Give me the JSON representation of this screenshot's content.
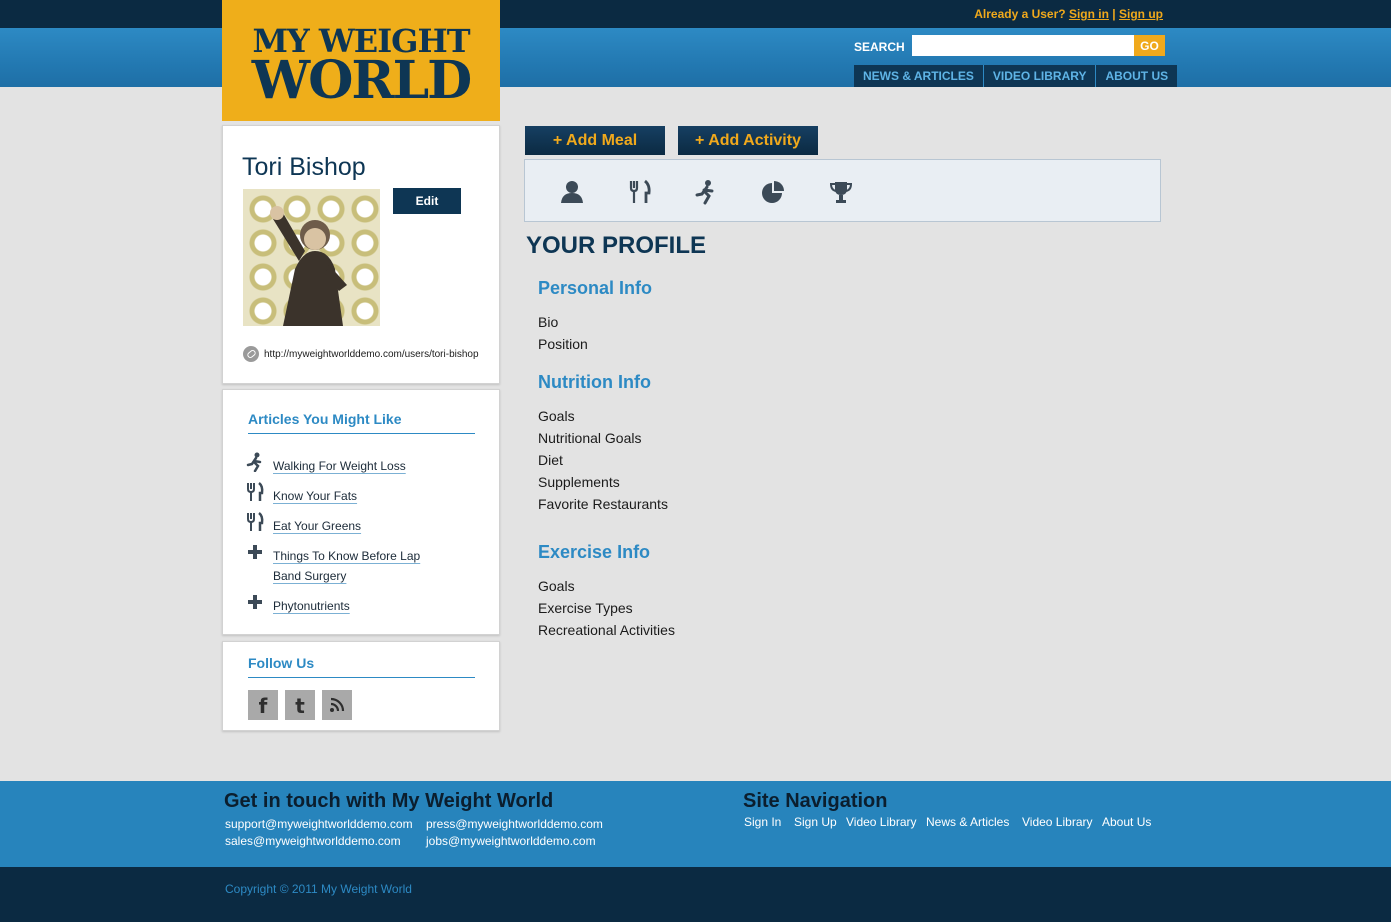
{
  "header": {
    "account_prompt": "Already a User?",
    "sign_in": "Sign in",
    "separator": "|",
    "sign_up": "Sign up",
    "search_label": "SEARCH",
    "search_value": "",
    "go_label": "GO",
    "nav": [
      "NEWS & ARTICLES",
      "VIDEO LIBRARY",
      "ABOUT US"
    ]
  },
  "logo": {
    "line1": "MY WEIGHT",
    "line2": "WORLD"
  },
  "profile": {
    "name": "Tori Bishop",
    "edit_label": "Edit",
    "url": "http://myweightworlddemo.com/users/tori-bishop"
  },
  "articles": {
    "title": "Articles You Might Like",
    "items": [
      {
        "icon": "runner-icon",
        "label": "Walking For Weight Loss"
      },
      {
        "icon": "fork-knife-icon",
        "label": "Know Your Fats"
      },
      {
        "icon": "fork-knife-icon",
        "label": "Eat Your Greens"
      },
      {
        "icon": "plus-icon",
        "label": "Things To Know Before Lap Band Surgery"
      },
      {
        "icon": "plus-icon",
        "label": "Phytonutrients"
      }
    ]
  },
  "follow": {
    "title": "Follow Us",
    "icons": [
      "facebook-icon",
      "twitter-icon",
      "rss-icon"
    ]
  },
  "actions": {
    "add_meal": "+ Add Meal",
    "add_activity": "+ Add Activity"
  },
  "toolbar_icons": [
    "profile-icon",
    "fork-knife-icon",
    "runner-icon",
    "pie-chart-icon",
    "trophy-icon"
  ],
  "main": {
    "title": "YOUR PROFILE",
    "sections": [
      {
        "title": "Personal Info",
        "fields": [
          "Bio",
          "Position"
        ]
      },
      {
        "title": "Nutrition Info",
        "fields": [
          "Goals",
          "Nutritional Goals",
          "Diet",
          "Supplements",
          "Favorite Restaurants"
        ]
      },
      {
        "title": "Exercise Info",
        "fields": [
          "Goals",
          "Exercise Types",
          "Recreational Activities"
        ]
      }
    ]
  },
  "footer": {
    "contact_title": "Get in touch with My Weight World",
    "emails": [
      "support@myweightworlddemo.com",
      "press@myweightworlddemo.com",
      "sales@myweightworlddemo.com",
      "jobs@myweightworlddemo.com"
    ],
    "nav_title": "Site Navigation",
    "nav": [
      "Sign In",
      "Sign Up",
      "Video Library",
      "News & Articles",
      "Video Library",
      "About Us"
    ],
    "copyright": "Copyright © 2011 My Weight World"
  },
  "colors": {
    "brand_yellow": "#efae1a",
    "navy": "#0e3654",
    "accent_blue": "#2d8ac4"
  }
}
